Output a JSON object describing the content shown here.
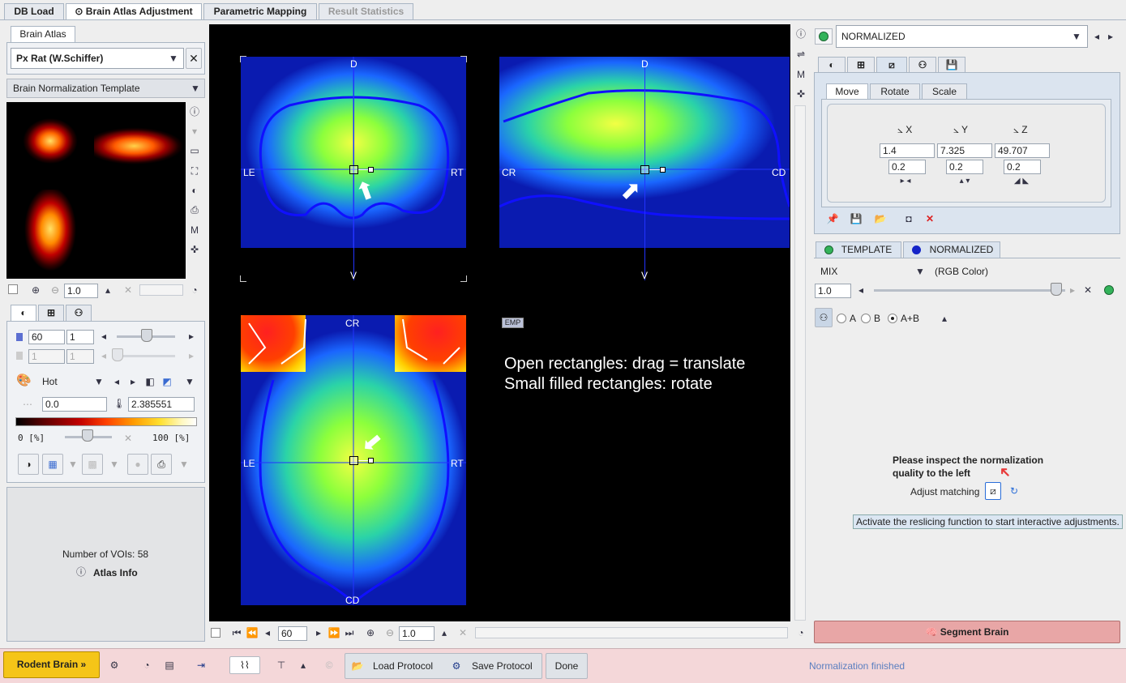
{
  "tabs": [
    {
      "label": "DB Load"
    },
    {
      "label": "Brain Atlas Adjustment"
    },
    {
      "label": "Parametric Mapping"
    },
    {
      "label": "Result Statistics"
    }
  ],
  "left": {
    "atlas_tab": "Brain Atlas",
    "atlas_select": "Px Rat (W.Schiffer)",
    "template_label": "Brain Normalization Template",
    "zoom_value": "1.0",
    "lut": {
      "min_a": "60",
      "min_b": "1",
      "max_a": "1",
      "max_b": "1",
      "colormap": "Hot",
      "lower": "0.0",
      "upper": "2.385551",
      "range_left": "0  [%]",
      "range_right": "100  [%]"
    },
    "voi_count": "Number of VOIs: 58",
    "atlas_info": "Atlas Info"
  },
  "viewer": {
    "hint_line1": "Open rectangles: drag = translate",
    "hint_line2": "Small filled rectangles: rotate",
    "emp_badge": "EMP",
    "labels": {
      "d": "D",
      "v": "V",
      "le": "LE",
      "rt": "RT",
      "cr": "CR",
      "cd": "CD"
    },
    "frame": "60",
    "zoom": "1.0"
  },
  "right": {
    "series_select": "NORMALIZED",
    "sub_tabs": [
      "Move",
      "Rotate",
      "Scale"
    ],
    "axes": [
      "X",
      "Y",
      "Z"
    ],
    "values": [
      "1.4",
      "7.325",
      "49.707"
    ],
    "steps": [
      "0.2",
      "0.2",
      "0.2"
    ],
    "template_tab": "TEMPLATE",
    "normalized_tab": "NORMALIZED",
    "mix_label": "MIX",
    "rgb_label": "(RGB Color)",
    "mix_value": "1.0",
    "radio_a": "A",
    "radio_b": "B",
    "radio_ab": "A+B",
    "inspect_line1": "Please inspect the normalization",
    "inspect_line2": "quality to the left",
    "adjust_label": "Adjust matching",
    "tooltip": "Activate the reslicing function to start interactive adjustments.",
    "segment_button": "Segment Brain"
  },
  "bottom": {
    "rodent_button": "Rodent Brain »",
    "load_protocol": "Load Protocol",
    "save_protocol": "Save Protocol",
    "done": "Done",
    "status": "Normalization finished"
  },
  "colors": {
    "status_bar": "#f4d7d9",
    "segment": "#e8a6a6",
    "rodent": "#f5c518",
    "tooltip": "#dbe6f2"
  }
}
